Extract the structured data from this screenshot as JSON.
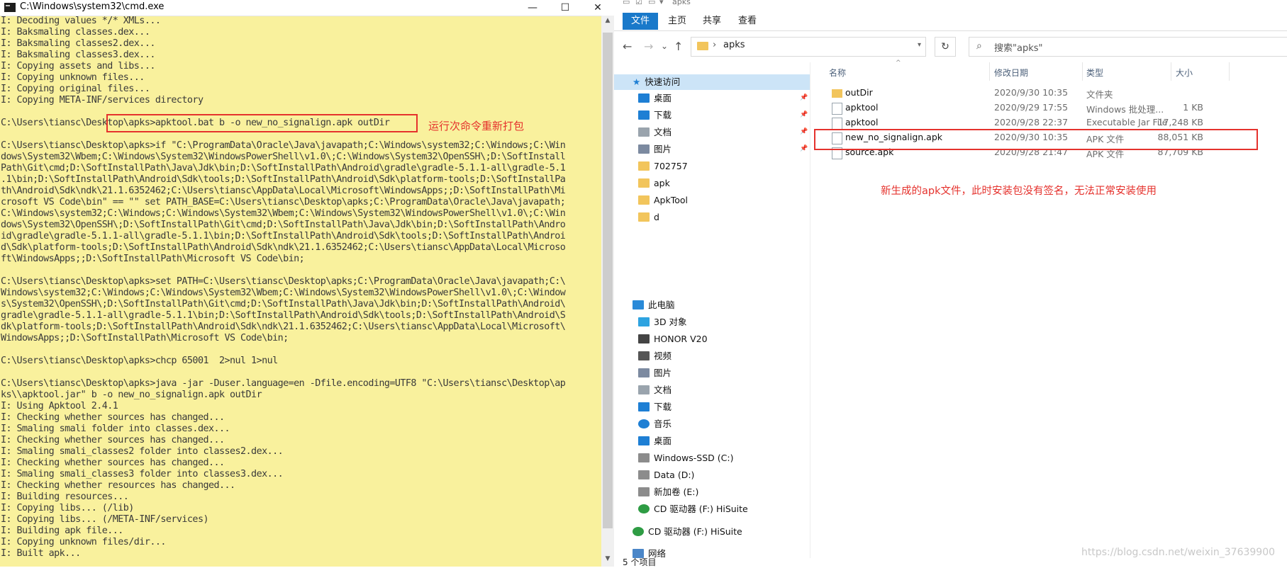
{
  "cmd": {
    "title": "C:\\Windows\\system32\\cmd.exe",
    "controls": {
      "minimize": "—",
      "maximize": "☐",
      "close": "✕"
    },
    "lines": [
      "I: Decoding values */* XMLs...",
      "I: Baksmaling classes.dex...",
      "I: Baksmaling classes2.dex...",
      "I: Baksmaling classes3.dex...",
      "I: Copying assets and libs...",
      "I: Copying unknown files...",
      "I: Copying original files...",
      "I: Copying META-INF/services directory",
      "",
      "C:\\Users\\tiansc\\Desktop\\apks>apktool.bat b -o new_no_signalign.apk outDir",
      "",
      "C:\\Users\\tiansc\\Desktop\\apks>if \"C:\\ProgramData\\Oracle\\Java\\javapath;C:\\Windows\\system32;C:\\Windows;C:\\Win",
      "dows\\System32\\Wbem;C:\\Windows\\System32\\WindowsPowerShell\\v1.0\\;C:\\Windows\\System32\\OpenSSH\\;D:\\SoftInstall",
      "Path\\Git\\cmd;D:\\SoftInstallPath\\Java\\Jdk\\bin;D:\\SoftInstallPath\\Android\\gradle\\gradle-5.1.1-all\\gradle-5.1",
      ".1\\bin;D:\\SoftInstallPath\\Android\\Sdk\\tools;D:\\SoftInstallPath\\Android\\Sdk\\platform-tools;D:\\SoftInstallPa",
      "th\\Android\\Sdk\\ndk\\21.1.6352462;C:\\Users\\tiansc\\AppData\\Local\\Microsoft\\WindowsApps;;D:\\SoftInstallPath\\Mi",
      "crosoft VS Code\\bin\" == \"\" set PATH_BASE=C:\\Users\\tiansc\\Desktop\\apks;C:\\ProgramData\\Oracle\\Java\\javapath;",
      "C:\\Windows\\system32;C:\\Windows;C:\\Windows\\System32\\Wbem;C:\\Windows\\System32\\WindowsPowerShell\\v1.0\\;C:\\Win",
      "dows\\System32\\OpenSSH\\;D:\\SoftInstallPath\\Git\\cmd;D:\\SoftInstallPath\\Java\\Jdk\\bin;D:\\SoftInstallPath\\Andro",
      "id\\gradle\\gradle-5.1.1-all\\gradle-5.1.1\\bin;D:\\SoftInstallPath\\Android\\Sdk\\tools;D:\\SoftInstallPath\\Androi",
      "d\\Sdk\\platform-tools;D:\\SoftInstallPath\\Android\\Sdk\\ndk\\21.1.6352462;C:\\Users\\tiansc\\AppData\\Local\\Microso",
      "ft\\WindowsApps;;D:\\SoftInstallPath\\Microsoft VS Code\\bin;",
      "",
      "C:\\Users\\tiansc\\Desktop\\apks>set PATH=C:\\Users\\tiansc\\Desktop\\apks;C:\\ProgramData\\Oracle\\Java\\javapath;C:\\",
      "Windows\\system32;C:\\Windows;C:\\Windows\\System32\\Wbem;C:\\Windows\\System32\\WindowsPowerShell\\v1.0\\;C:\\Window",
      "s\\System32\\OpenSSH\\;D:\\SoftInstallPath\\Git\\cmd;D:\\SoftInstallPath\\Java\\Jdk\\bin;D:\\SoftInstallPath\\Android\\",
      "gradle\\gradle-5.1.1-all\\gradle-5.1.1\\bin;D:\\SoftInstallPath\\Android\\Sdk\\tools;D:\\SoftInstallPath\\Android\\S",
      "dk\\platform-tools;D:\\SoftInstallPath\\Android\\Sdk\\ndk\\21.1.6352462;C:\\Users\\tiansc\\AppData\\Local\\Microsoft\\",
      "WindowsApps;;D:\\SoftInstallPath\\Microsoft VS Code\\bin;",
      "",
      "C:\\Users\\tiansc\\Desktop\\apks>chcp 65001  2>nul 1>nul",
      "",
      "C:\\Users\\tiansc\\Desktop\\apks>java -jar -Duser.language=en -Dfile.encoding=UTF8 \"C:\\Users\\tiansc\\Desktop\\ap",
      "ks\\\\apktool.jar\" b -o new_no_signalign.apk outDir",
      "I: Using Apktool 2.4.1",
      "I: Checking whether sources has changed...",
      "I: Smaling smali folder into classes.dex...",
      "I: Checking whether sources has changed...",
      "I: Smaling smali_classes2 folder into classes2.dex...",
      "I: Checking whether sources has changed...",
      "I: Smaling smali_classes3 folder into classes3.dex...",
      "I: Checking whether resources has changed...",
      "I: Building resources...",
      "I: Copying libs... (/lib)",
      "I: Copying libs... (/META-INF/services)",
      "I: Building apk file...",
      "I: Copying unknown files/dir...",
      "I: Built apk..."
    ]
  },
  "annotations": {
    "cmd_note": "运行次命令重新打包",
    "explorer_note": "新生成的apk文件，此时安装包没有签名，无法正常安装使用",
    "accent": "#e5322d"
  },
  "explorer": {
    "qa_title": "apks",
    "tabs": [
      "文件",
      "主页",
      "共享",
      "查看"
    ],
    "nav": {
      "back": "←",
      "forward": "→",
      "recent": "⌄",
      "up": "↑"
    },
    "address": {
      "separator": "›",
      "path": "apks"
    },
    "refresh": "↻",
    "search_placeholder": "搜索\"apks\"",
    "search_icon": "search-icon",
    "quick_access": "快速访问",
    "quick_items": [
      {
        "label": "桌面",
        "icon": "desktop-icon",
        "color": "#1e7fd4"
      },
      {
        "label": "下载",
        "icon": "download-icon",
        "color": "#1e7fd4"
      },
      {
        "label": "文档",
        "icon": "document-icon",
        "color": "#9aa4ad"
      },
      {
        "label": "图片",
        "icon": "picture-icon",
        "color": "#7c8aa0"
      },
      {
        "label": "702757",
        "icon": "folder-icon",
        "color": "#f2c55c"
      },
      {
        "label": "apk",
        "icon": "folder-icon",
        "color": "#f2c55c"
      },
      {
        "label": "ApkTool",
        "icon": "folder-icon",
        "color": "#f2c55c"
      },
      {
        "label": "d",
        "icon": "folder-icon",
        "color": "#f2c55c"
      }
    ],
    "this_pc": "此电脑",
    "pc_items": [
      {
        "label": "3D 对象",
        "icon": "3d-objects-icon",
        "color": "#2ea3e0"
      },
      {
        "label": "HONOR V20",
        "icon": "phone-icon",
        "color": "#444444"
      },
      {
        "label": "视频",
        "icon": "video-icon",
        "color": "#555555"
      },
      {
        "label": "图片",
        "icon": "picture-icon",
        "color": "#7c8aa0"
      },
      {
        "label": "文档",
        "icon": "document-icon",
        "color": "#9aa4ad"
      },
      {
        "label": "下载",
        "icon": "download-icon",
        "color": "#1e7fd4"
      },
      {
        "label": "音乐",
        "icon": "music-icon",
        "color": "#1e7fd4"
      },
      {
        "label": "桌面",
        "icon": "desktop-icon",
        "color": "#1e7fd4"
      },
      {
        "label": "Windows-SSD (C:)",
        "icon": "drive-icon",
        "color": "#8c8c8c"
      },
      {
        "label": "Data (D:)",
        "icon": "drive-icon",
        "color": "#8c8c8c"
      },
      {
        "label": "新加卷 (E:)",
        "icon": "drive-icon",
        "color": "#8c8c8c"
      },
      {
        "label": "CD 驱动器 (F:) HiSuite",
        "icon": "cd-drive-icon",
        "color": "#2e9c44"
      }
    ],
    "cd_drive": "CD 驱动器 (F:) HiSuite",
    "network": "网络",
    "columns": {
      "name": "名称",
      "date": "修改日期",
      "type": "类型",
      "size": "大小"
    },
    "files": [
      {
        "name": "outDir",
        "date": "2020/9/30 10:35",
        "type": "文件夹",
        "size": "",
        "icon": "folder-icon"
      },
      {
        "name": "apktool",
        "date": "2020/9/29 17:55",
        "type": "Windows 批处理...",
        "size": "1 KB",
        "icon": "batch-file-icon"
      },
      {
        "name": "apktool",
        "date": "2020/9/28 22:37",
        "type": "Executable Jar File",
        "size": "17,248 KB",
        "icon": "jar-file-icon"
      },
      {
        "name": "new_no_signalign.apk",
        "date": "2020/9/30 10:35",
        "type": "APK 文件",
        "size": "88,051 KB",
        "icon": "apk-file-icon"
      },
      {
        "name": "source.apk",
        "date": "2020/9/28 21:47",
        "type": "APK 文件",
        "size": "87,709 KB",
        "icon": "apk-file-icon"
      }
    ],
    "status": "5 个项目"
  },
  "watermark": "https://blog.csdn.net/weixin_37639900"
}
